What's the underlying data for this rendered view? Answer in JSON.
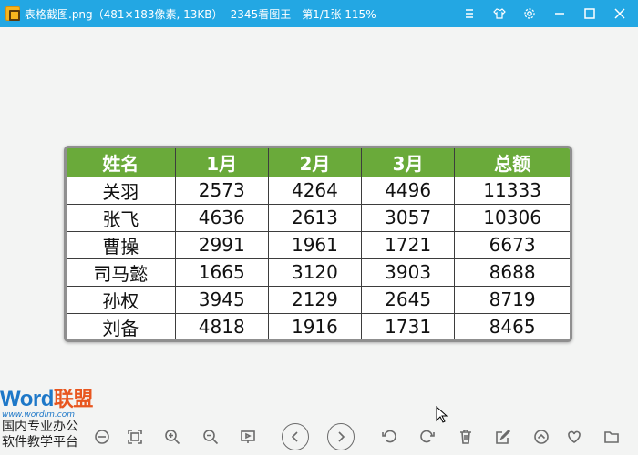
{
  "window": {
    "title": "表格截图.png（481×183像素, 13KB）- 2345看图王 - 第1/1张 115%",
    "controls": [
      "menu-icon",
      "skin-icon",
      "settings-icon",
      "minimize-icon",
      "maximize-icon",
      "close-icon"
    ]
  },
  "table": {
    "headers": [
      "姓名",
      "1月",
      "2月",
      "3月",
      "总额"
    ],
    "rows": [
      [
        "关羽",
        "2573",
        "4264",
        "4496",
        "11333"
      ],
      [
        "张飞",
        "4636",
        "2613",
        "3057",
        "10306"
      ],
      [
        "曹操",
        "2991",
        "1961",
        "1721",
        "6673"
      ],
      [
        "司马懿",
        "1665",
        "3120",
        "3903",
        "8688"
      ],
      [
        "孙权",
        "3945",
        "2129",
        "2645",
        "8719"
      ],
      [
        "刘备",
        "4818",
        "1916",
        "1731",
        "8465"
      ]
    ],
    "header_color": "#6aaa3a"
  },
  "watermark": {
    "logo_word": "Word",
    "logo_cn": "联盟",
    "url": "www.wordlm.com",
    "line1": "国内专业办公",
    "line2": "软件教学平台"
  },
  "toolbar": {
    "buttons": [
      "actual-size",
      "fit-window",
      "zoom-in",
      "zoom-out",
      "slideshow",
      "previous",
      "next",
      "rotate-left",
      "rotate-right",
      "delete",
      "edit",
      "up",
      "favorite",
      "open-folder"
    ]
  }
}
